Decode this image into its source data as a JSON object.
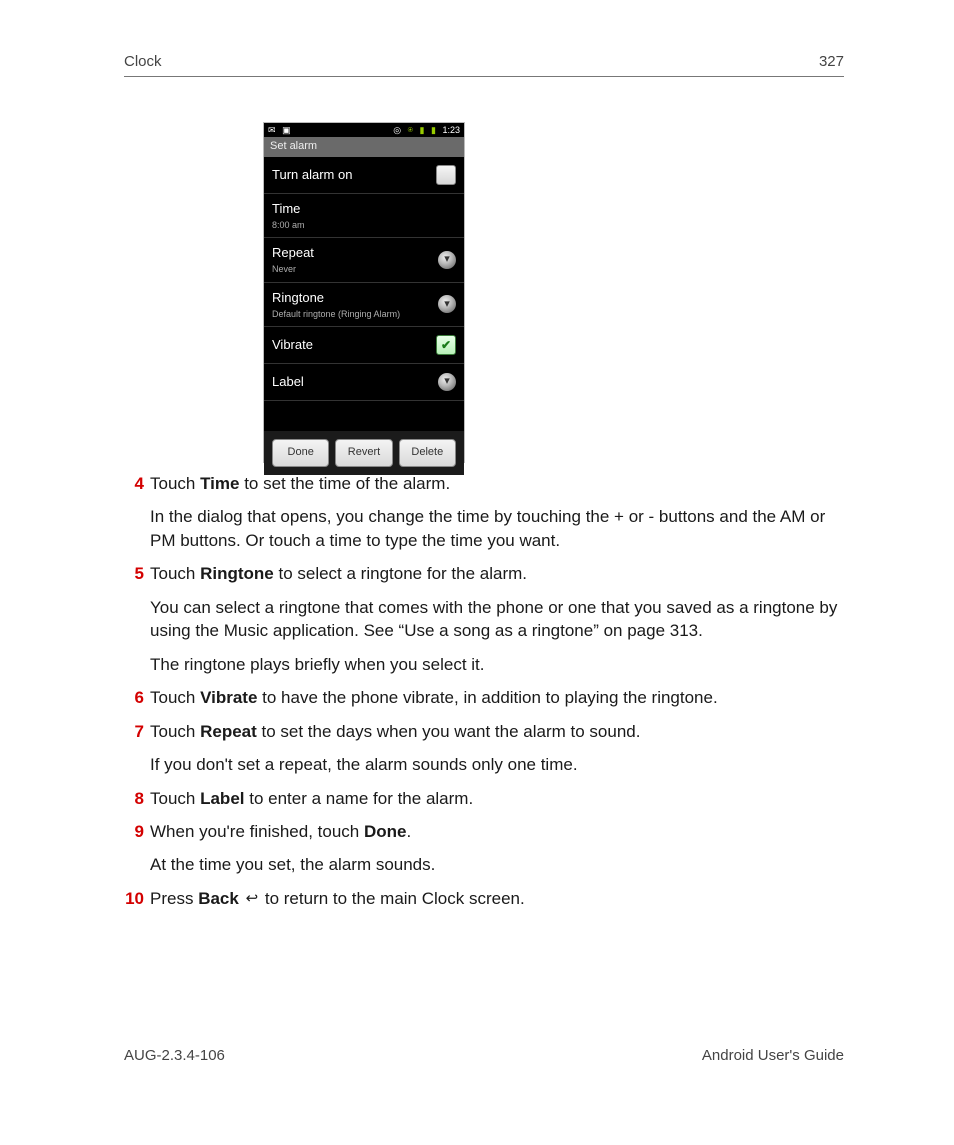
{
  "header": {
    "section": "Clock",
    "page_number": "327"
  },
  "footer": {
    "left": "AUG-2.3.4-106",
    "right": "Android User's Guide"
  },
  "phone": {
    "status_time": "1:23",
    "title": "Set alarm",
    "rows": {
      "turn_on": {
        "label": "Turn alarm on"
      },
      "time": {
        "label": "Time",
        "sub": "8:00 am"
      },
      "repeat": {
        "label": "Repeat",
        "sub": "Never"
      },
      "ringtone": {
        "label": "Ringtone",
        "sub": "Default ringtone (Ringing Alarm)"
      },
      "vibrate": {
        "label": "Vibrate"
      },
      "label": {
        "label": "Label"
      }
    },
    "buttons": {
      "done": "Done",
      "revert": "Revert",
      "delete": "Delete"
    }
  },
  "steps": {
    "s4_a": "Touch ",
    "s4_bold": "Time",
    "s4_b": " to set the time of the alarm.",
    "s4_p": "In the dialog that opens, you change the time by touching the + or - buttons and the AM or PM buttons. Or touch a time to type the time you want.",
    "s5_a": "Touch ",
    "s5_bold": "Ringtone",
    "s5_b": " to select a ringtone for the alarm.",
    "s5_p1": "You can select a ringtone that comes with the phone or one that you saved as a ringtone by using the Music application. See “Use a song as a ringtone” on page 313.",
    "s5_p2": "The ringtone plays briefly when you select it.",
    "s6_a": "Touch ",
    "s6_bold": "Vibrate",
    "s6_b": " to have the phone vibrate, in addition to playing the ringtone.",
    "s7_a": "Touch ",
    "s7_bold": "Repeat",
    "s7_b": " to set the days when you want the alarm to sound.",
    "s7_p": "If you don't set a repeat, the alarm sounds only one time.",
    "s8_a": "Touch ",
    "s8_bold": "Label",
    "s8_b": " to enter a name for the alarm.",
    "s9_a": "When you're finished, touch ",
    "s9_bold": "Done",
    "s9_b": ".",
    "s9_p": "At the time you set, the alarm sounds.",
    "s10_a": "Press ",
    "s10_bold": "Back",
    "s10_b": " to return to the main Clock screen.",
    "n4": "4",
    "n5": "5",
    "n6": "6",
    "n7": "7",
    "n8": "8",
    "n9": "9",
    "n10": "10"
  }
}
